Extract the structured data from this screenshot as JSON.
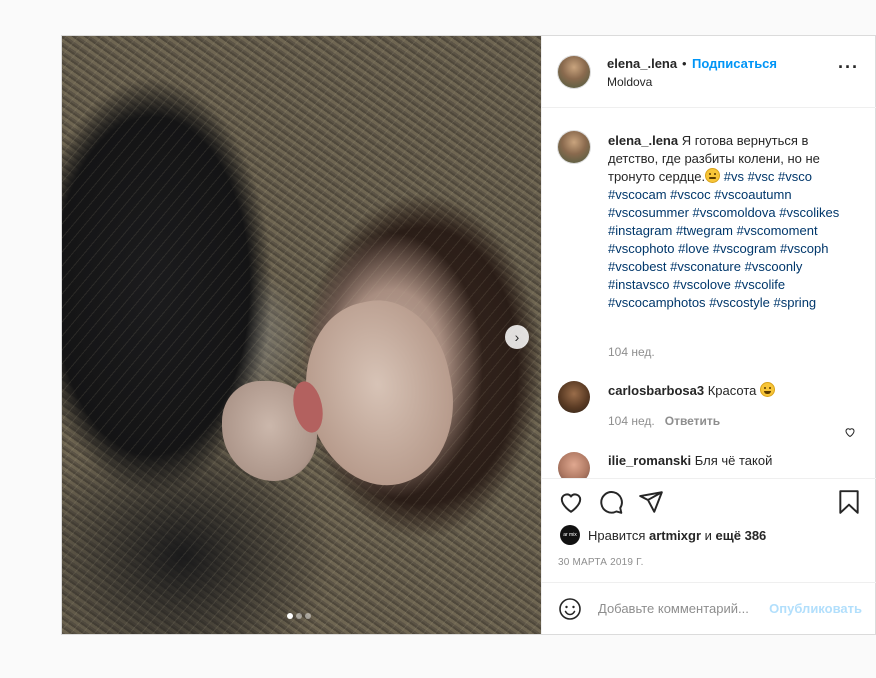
{
  "post": {
    "username": "elena_.lena",
    "follow_label": "Подписаться",
    "separator": "•",
    "location": "Moldova",
    "more_icon": "more-horizontal-icon"
  },
  "caption": {
    "username": "elena_.lena",
    "text": "Я готова вернуться в детство, где разбиты колени, но не тронуто сердце.",
    "hashtags": [
      "#vs",
      "#vsc",
      "#vsco",
      "#vscocam",
      "#vscoc",
      "#vscoautumn",
      "#vscosummer",
      "#vscomoldova",
      "#vscolikes",
      "#instagram",
      "#twegram",
      "#vscomoment",
      "#vscophoto",
      "#love",
      "#vscogram",
      "#vscoph",
      "#vscobest",
      "#vsconature",
      "#vscoonly",
      "#instavsco",
      "#vscolove",
      "#vscolife",
      "#vscocamphotos",
      "#vscostyle",
      "#spring"
    ],
    "time": "104 нед."
  },
  "comments": [
    {
      "username": "carlosbarbosa3",
      "text": "Красота",
      "time": "104 нед.",
      "reply_label": "Ответить"
    },
    {
      "username": "ilie_romanski",
      "text": "Бля чё такой"
    }
  ],
  "likes": {
    "prefix": "Нравится",
    "user": "artmixgr",
    "middle": "и",
    "count_text": "ещё 386",
    "avatar_text": "ar mix"
  },
  "date": "30 МАРТА 2019 Г.",
  "add_comment": {
    "placeholder": "Добавьте комментарий...",
    "publish_label": "Опубликовать"
  },
  "carousel": {
    "slide_count": 3,
    "active_index": 0
  },
  "colors": {
    "link": "#00376b",
    "follow": "#0095f6",
    "publish_disabled": "#b2dffc",
    "meta": "#8e8e8e"
  }
}
